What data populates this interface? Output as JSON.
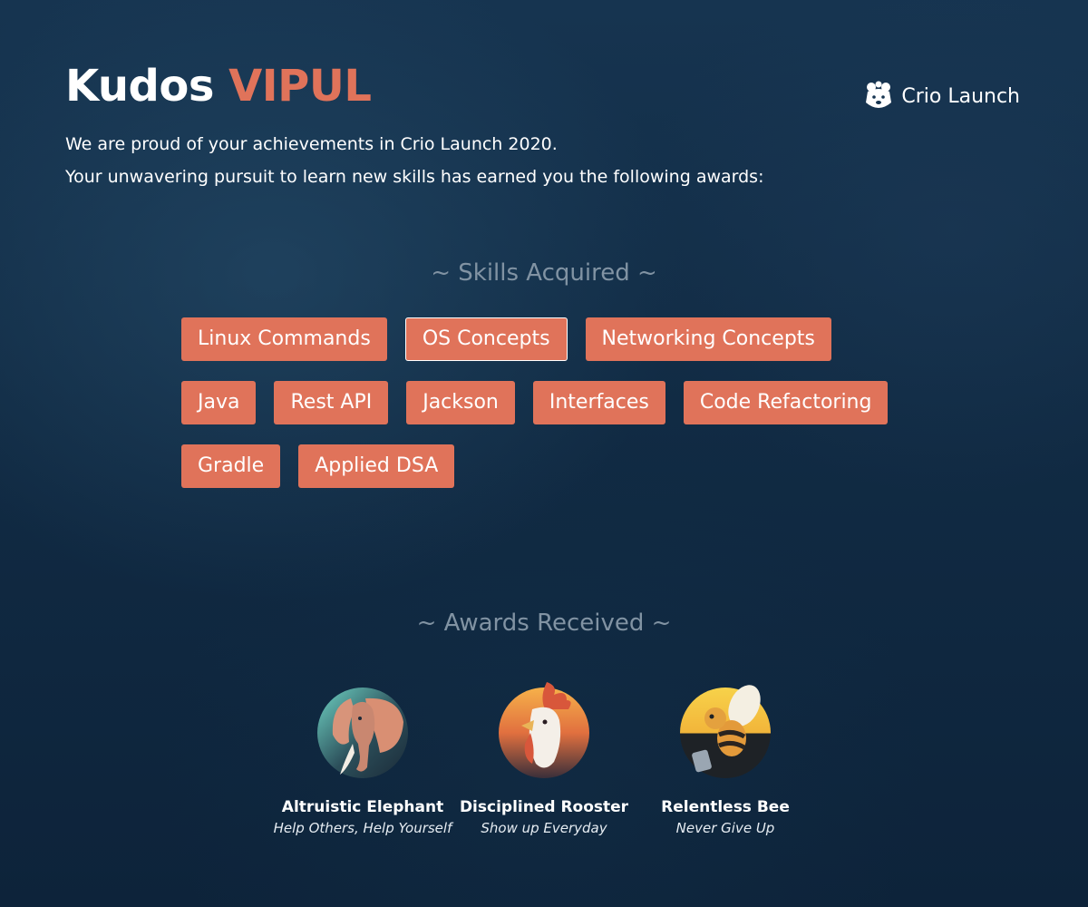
{
  "header": {
    "greeting": "Kudos",
    "name": "VIPUL",
    "line1": "We are proud of your achievements in Crio Launch 2020.",
    "line2": "Your unwavering pursuit to learn new skills has earned you the following awards:"
  },
  "brand": {
    "name": "Crio Launch",
    "icon": "bear-logo-icon"
  },
  "colors": {
    "accent": "#e0735a",
    "section_title": "#8193a3",
    "background": "#12304a"
  },
  "skills": {
    "title": "~ Skills Acquired ~",
    "rows": [
      [
        "Linux Commands",
        "OS Concepts",
        "Networking Concepts"
      ],
      [
        "Java",
        "Rest API",
        "Jackson",
        "Interfaces",
        "Code Refactoring"
      ],
      [
        "Gradle",
        "Applied DSA"
      ]
    ]
  },
  "awards": {
    "title": "~ Awards Received ~",
    "items": [
      {
        "title": "Altruistic Elephant",
        "tagline": "Help Others, Help Yourself",
        "icon": "elephant-icon"
      },
      {
        "title": "Disciplined Rooster",
        "tagline": "Show up Everyday",
        "icon": "rooster-icon"
      },
      {
        "title": "Relentless Bee",
        "tagline": "Never Give Up",
        "icon": "bee-icon"
      }
    ]
  }
}
